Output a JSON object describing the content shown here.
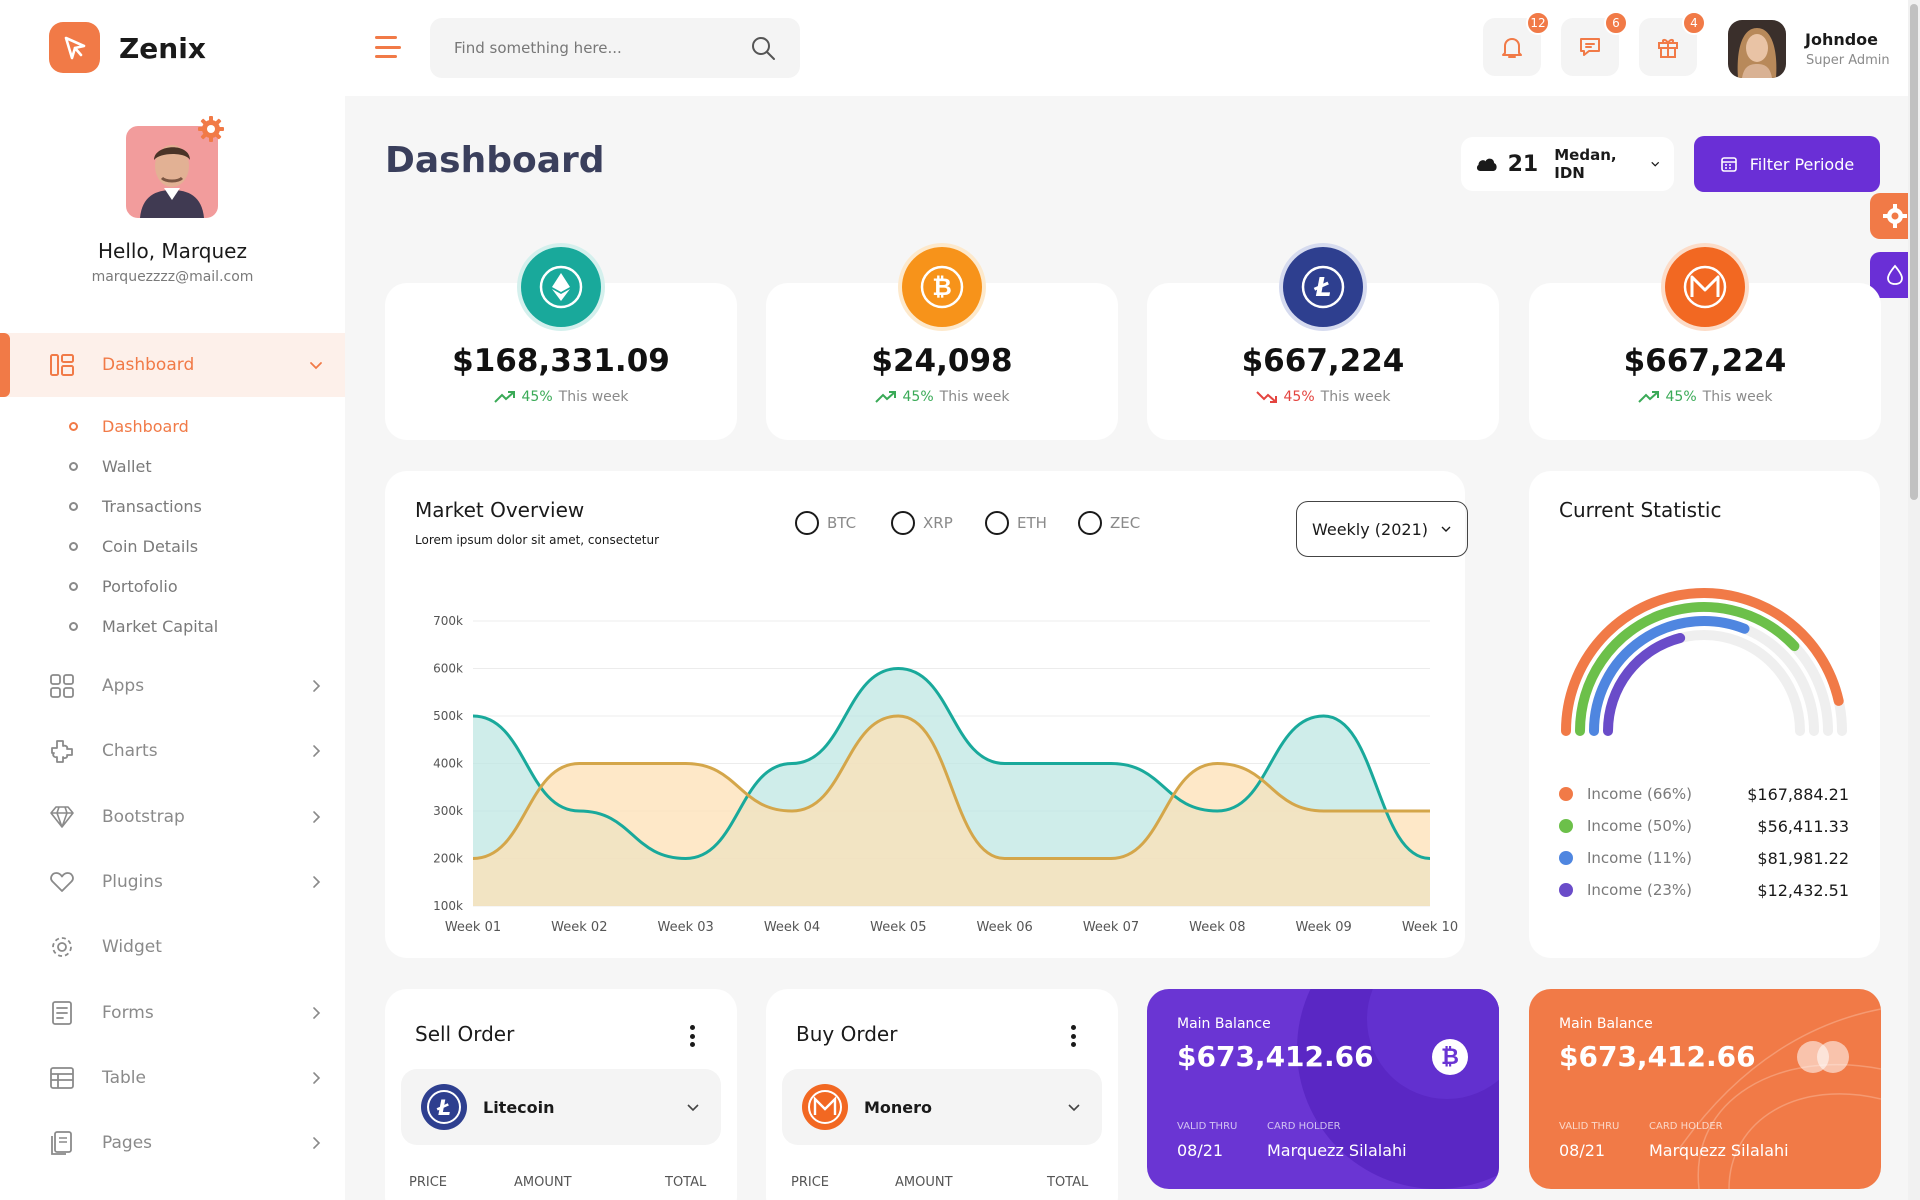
{
  "app": {
    "brand": "Zenix",
    "search_placeholder": "Find something here...",
    "notifications": [
      {
        "icon": "bell-icon",
        "count": "12"
      },
      {
        "icon": "chat-icon",
        "count": "6"
      },
      {
        "icon": "gift-icon",
        "count": "4"
      }
    ],
    "user": {
      "name": "Johndoe",
      "role": "Super Admin"
    }
  },
  "sidebar": {
    "greeting": "Hello, Marquez",
    "email": "marquezzzz@mail.com",
    "active": {
      "label": "Dashboard",
      "icon": "dashboard-icon"
    },
    "submenu": [
      "Dashboard",
      "Wallet",
      "Transactions",
      "Coin Details",
      "Portofolio",
      "Market Capital"
    ],
    "items": [
      {
        "label": "Apps",
        "icon": "apps-icon",
        "chevron": true
      },
      {
        "label": "Charts",
        "icon": "charts-icon",
        "chevron": true
      },
      {
        "label": "Bootstrap",
        "icon": "diamond-icon",
        "chevron": true
      },
      {
        "label": "Plugins",
        "icon": "heart-icon",
        "chevron": true
      },
      {
        "label": "Widget",
        "icon": "gear-icon",
        "chevron": false
      },
      {
        "label": "Forms",
        "icon": "forms-icon",
        "chevron": true
      },
      {
        "label": "Table",
        "icon": "table-icon",
        "chevron": true
      },
      {
        "label": "Pages",
        "icon": "pages-icon",
        "chevron": true
      }
    ]
  },
  "header": {
    "title": "Dashboard",
    "weather": {
      "temp": "21",
      "city": "Medan, IDN"
    },
    "filter_label": "Filter Periode"
  },
  "stats": [
    {
      "coin": "ethereum-icon",
      "color": "#19a99b",
      "value": "$168,331.09",
      "pct": "45%",
      "trend": "up",
      "label": "This week"
    },
    {
      "coin": "bitcoin-icon",
      "color": "#f7931a",
      "value": "$24,098",
      "pct": "45%",
      "trend": "up",
      "label": "This week"
    },
    {
      "coin": "litecoin-icon",
      "color": "#2e3f8f",
      "value": "$667,224",
      "pct": "45%",
      "trend": "down",
      "label": "This week"
    },
    {
      "coin": "monero-icon",
      "color": "#f26822",
      "value": "$667,224",
      "pct": "45%",
      "trend": "up",
      "label": "This week"
    }
  ],
  "market": {
    "title": "Market Overview",
    "subtitle": "Lorem ipsum dolor sit amet, consectetur",
    "filters": [
      "BTC",
      "XRP",
      "ETH",
      "ZEC"
    ],
    "period": "Weekly (2021)"
  },
  "chart_data": {
    "type": "area",
    "x": [
      "Week 01",
      "Week 02",
      "Week 03",
      "Week 04",
      "Week 05",
      "Week 06",
      "Week 07",
      "Week 08",
      "Week 09",
      "Week 10"
    ],
    "y_ticks": [
      "700k",
      "600k",
      "500k",
      "400k",
      "300k",
      "200k",
      "100k"
    ],
    "ylim": [
      100000,
      700000
    ],
    "grid": true,
    "series": [
      {
        "color": "#19a99b",
        "fill": "#bfe7e3",
        "values": [
          500000,
          300000,
          200000,
          400000,
          600000,
          400000,
          400000,
          300000,
          500000,
          200000
        ]
      },
      {
        "color": "#d4a64a",
        "fill": "#fde0b5",
        "values": [
          200000,
          400000,
          400000,
          300000,
          500000,
          200000,
          200000,
          400000,
          300000,
          300000
        ]
      }
    ]
  },
  "statistic": {
    "title": "Current Statistic",
    "rows": [
      {
        "label": "Income (66%)",
        "value": "$167,884.21",
        "color": "#f17a47",
        "pct": 66
      },
      {
        "label": "Income (50%)",
        "value": "$56,411.33",
        "color": "#6cc04a",
        "pct": 50
      },
      {
        "label": "Income (11%)",
        "value": "$81,981.22",
        "color": "#4f86e0",
        "pct": 11
      },
      {
        "label": "Income (23%)",
        "value": "$12,432.51",
        "color": "#6a4cc9",
        "pct": 23
      }
    ]
  },
  "orders": [
    {
      "title": "Sell Order",
      "coin": "Litecoin",
      "coin_icon": "litecoin-icon",
      "coin_color": "#2e3f8f",
      "headers": [
        "PRICE",
        "AMOUNT",
        "TOTAL"
      ]
    },
    {
      "title": "Buy Order",
      "coin": "Monero",
      "coin_icon": "monero-icon",
      "coin_color": "#f26822",
      "headers": [
        "PRICE",
        "AMOUNT",
        "TOTAL"
      ]
    }
  ],
  "balances": [
    {
      "label": "Main Balance",
      "value": "$673,412.66",
      "valid_label": "VALID THRU",
      "valid": "08/21",
      "holder_label": "CARD HOLDER",
      "holder": "Marquezz Silalahi",
      "bg": "#6a35d3",
      "icon": "bitcoin-icon"
    },
    {
      "label": "Main Balance",
      "value": "$673,412.66",
      "valid_label": "VALID THRU",
      "valid": "08/21",
      "holder_label": "CARD HOLDER",
      "holder": "Marquezz Silalahi",
      "bg": "#f17a47",
      "icon": "mastercard-icon"
    }
  ]
}
